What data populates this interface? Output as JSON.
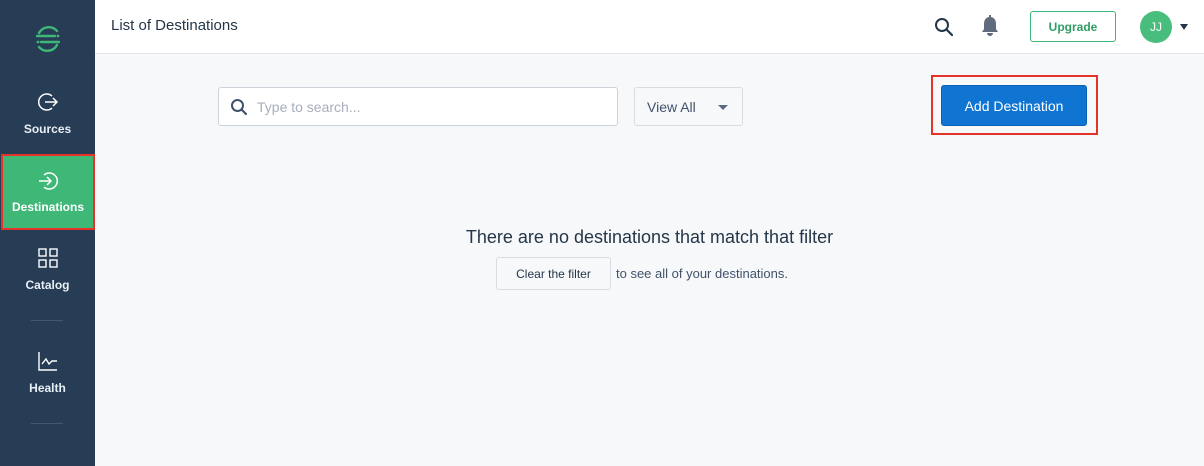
{
  "sidebar": {
    "items": [
      {
        "label": "Sources",
        "icon": "arrow-out-circle-icon"
      },
      {
        "label": "Destinations",
        "icon": "arrow-in-circle-icon",
        "active": true
      },
      {
        "label": "Catalog",
        "icon": "grid-icon"
      },
      {
        "label": "Health",
        "icon": "chart-line-icon"
      }
    ],
    "logo_icon": "segment-logo-icon"
  },
  "header": {
    "title": "List of Destinations",
    "upgrade_label": "Upgrade",
    "avatar_initials": "JJ"
  },
  "filters": {
    "search_placeholder": "Type to search...",
    "view_selected": "View All"
  },
  "actions": {
    "add_destination_label": "Add Destination"
  },
  "empty_state": {
    "title": "There are no destinations that match that filter",
    "clear_label": "Clear the filter",
    "suffix": "to see all of your destinations."
  },
  "colors": {
    "sidebar_bg": "#273c55",
    "active_green": "#3fb877",
    "primary_blue": "#0f74d2",
    "highlight_red": "#e6332a"
  }
}
